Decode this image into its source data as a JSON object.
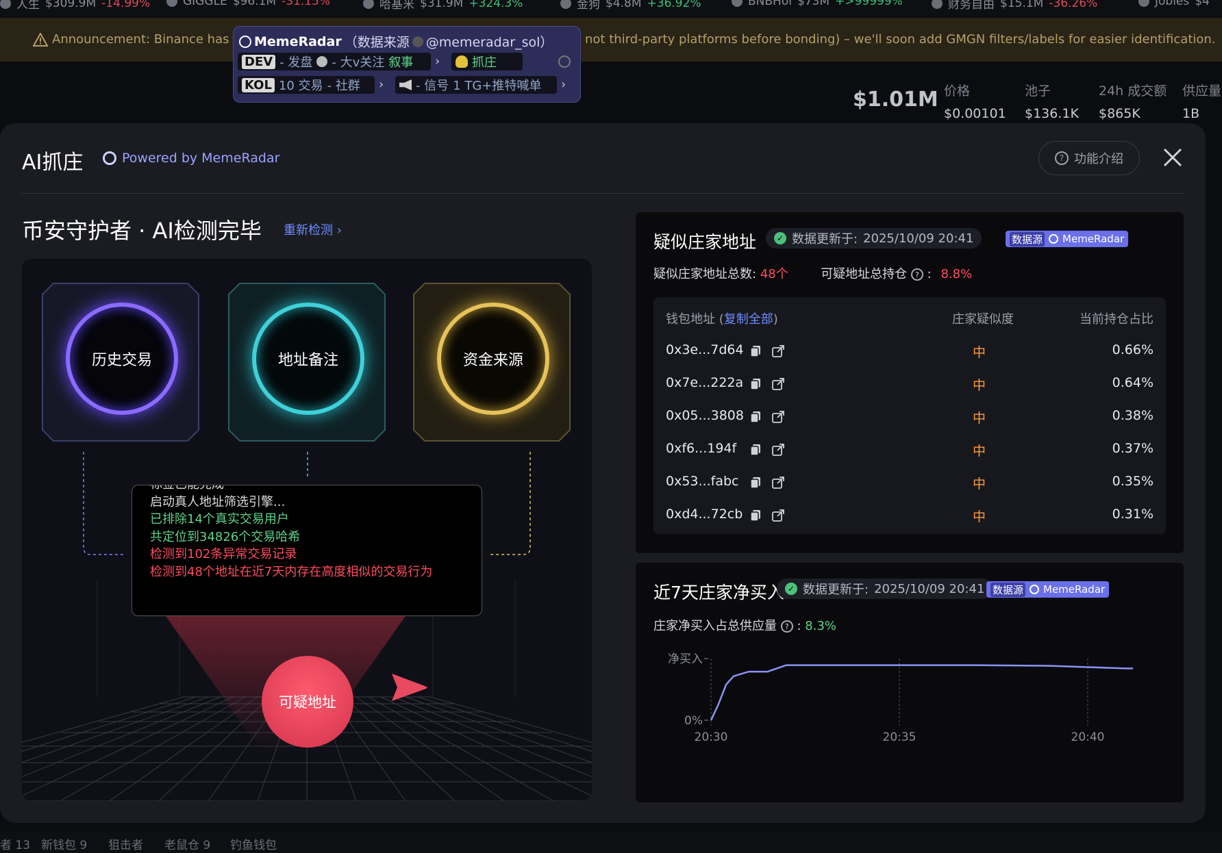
{
  "ticker": [
    {
      "name": "人生",
      "cap": "$309.9M",
      "chg": "-14.99%"
    },
    {
      "name": "GIGGLE",
      "cap": "$96.1M",
      "chg": "-31.15%"
    },
    {
      "name": "哈基米",
      "cap": "$31.9M",
      "chg": "+324.3%"
    },
    {
      "name": "金狗",
      "cap": "$4.8M",
      "chg": "+36.92%"
    },
    {
      "name": "BNBHol",
      "cap": "$73M",
      "chg": "+>99999%"
    },
    {
      "name": "财务自由",
      "cap": "$15.1M",
      "chg": "-36.26%"
    },
    {
      "name": "Jobles",
      "cap": "$4"
    }
  ],
  "announcement": {
    "part1": "Announcement: Binance has la",
    "part2": "not third-party platforms before bonding) – we'll soon add GMGN filters/labels for easier identification."
  },
  "memeradar_popup": {
    "brand": "MemeRadar",
    "source_note": "（数据来源",
    "handle": "@memeradar_sol）",
    "row1": [
      {
        "tag": "DEV",
        "text": "- 发盘"
      },
      {
        "text": "- 大v关注"
      },
      {
        "text": "叙事"
      },
      {
        "text": "抓庄"
      }
    ],
    "row2": [
      {
        "tag": "KOL",
        "text": "10 交易"
      },
      {
        "text": "- 社群"
      },
      {
        "text": "- 信号"
      },
      {
        "text": "1 TG+推特喊单"
      }
    ]
  },
  "market_stats": {
    "market_cap": "$1.01M",
    "items": [
      {
        "label": "价格",
        "value": "$0.00101"
      },
      {
        "label": "池子",
        "value": "$136.1K"
      },
      {
        "label": "24h 成交额",
        "value": "$865K"
      },
      {
        "label": "供应量",
        "value": "1B"
      }
    ]
  },
  "modal": {
    "title": "AI抓庄",
    "powered": "Powered by MemeRadar",
    "help": "功能介绍",
    "subhead": "币安守护者 · AI检测完毕",
    "recheck": "重新检测 ›",
    "cards": [
      {
        "label": "历史交易",
        "color": "#8b6bff"
      },
      {
        "label": "地址备注",
        "color": "#3fd0d8"
      },
      {
        "label": "资金来源",
        "color": "#e6c25a"
      }
    ],
    "log_lines": [
      {
        "text": "标签已能完成",
        "cls": "w"
      },
      {
        "text": "启动真人地址筛选引擎...",
        "cls": "w"
      },
      {
        "text": "已排除14个真实交易用户",
        "cls": "g"
      },
      {
        "text": "共定位到34826个交易哈希",
        "cls": "g"
      },
      {
        "text": "检测到102条异常交易记录",
        "cls": "r"
      },
      {
        "text": "检测到48个地址在近7天内存在高度相似的交易行为",
        "cls": "r"
      }
    ],
    "suspect_button": "可疑地址"
  },
  "panel_addresses": {
    "title": "疑似庄家地址",
    "updated_label": "数据更新于:",
    "updated_time": "2025/10/09 20:41",
    "source_label": "数据源",
    "source_name": "MemeRadar",
    "total_label": "疑似庄家地址总数:",
    "total_value": "48个",
    "holding_label": "可疑地址总持仓",
    "holding_value": "8.8%",
    "columns": {
      "address": "钱包地址 (",
      "copy_all": "复制全部",
      "address_close": ")",
      "similarity": "庄家疑似度",
      "holding": "当前持仓占比"
    },
    "rows": [
      {
        "address": "0x3e...7d64",
        "level": "中",
        "pct": "0.66%"
      },
      {
        "address": "0x7e...222a",
        "level": "中",
        "pct": "0.64%"
      },
      {
        "address": "0x05...3808",
        "level": "中",
        "pct": "0.38%"
      },
      {
        "address": "0xf6...194f",
        "level": "中",
        "pct": "0.37%"
      },
      {
        "address": "0x53...fabc",
        "level": "中",
        "pct": "0.35%"
      },
      {
        "address": "0xd4...72cb",
        "level": "中",
        "pct": "0.31%"
      }
    ]
  },
  "panel_netbuy": {
    "title": "近7天庄家净买入",
    "updated_label": "数据更新于:",
    "updated_time": "2025/10/09 20:41",
    "source_label": "数据源",
    "source_name": "MemeRadar",
    "ratio_label": "庄家净买入占总供应量",
    "ratio_value": "8.3%"
  },
  "chart_data": {
    "type": "line",
    "ylabel": "净买入",
    "y_ticks": [
      "0%"
    ],
    "x_ticks": [
      "20:30",
      "20:35",
      "20:40"
    ],
    "color": "#8c93f5",
    "x": [
      "20:30",
      "20:30.2",
      "20:30.4",
      "20:30.6",
      "20:31",
      "20:31.5",
      "20:32",
      "20:33",
      "20:35",
      "20:37",
      "20:39",
      "20:40",
      "20:41",
      "20:41.2"
    ],
    "y": [
      0.0,
      2.5,
      5.5,
      6.8,
      7.5,
      7.5,
      8.5,
      8.5,
      8.5,
      8.5,
      8.4,
      8.2,
      8.0,
      8.0
    ],
    "grid_x": true
  },
  "bottom_tabs": [
    "者 13",
    "新钱包 9",
    "狙击者",
    "老鼠仓 9",
    "钓鱼钱包"
  ]
}
